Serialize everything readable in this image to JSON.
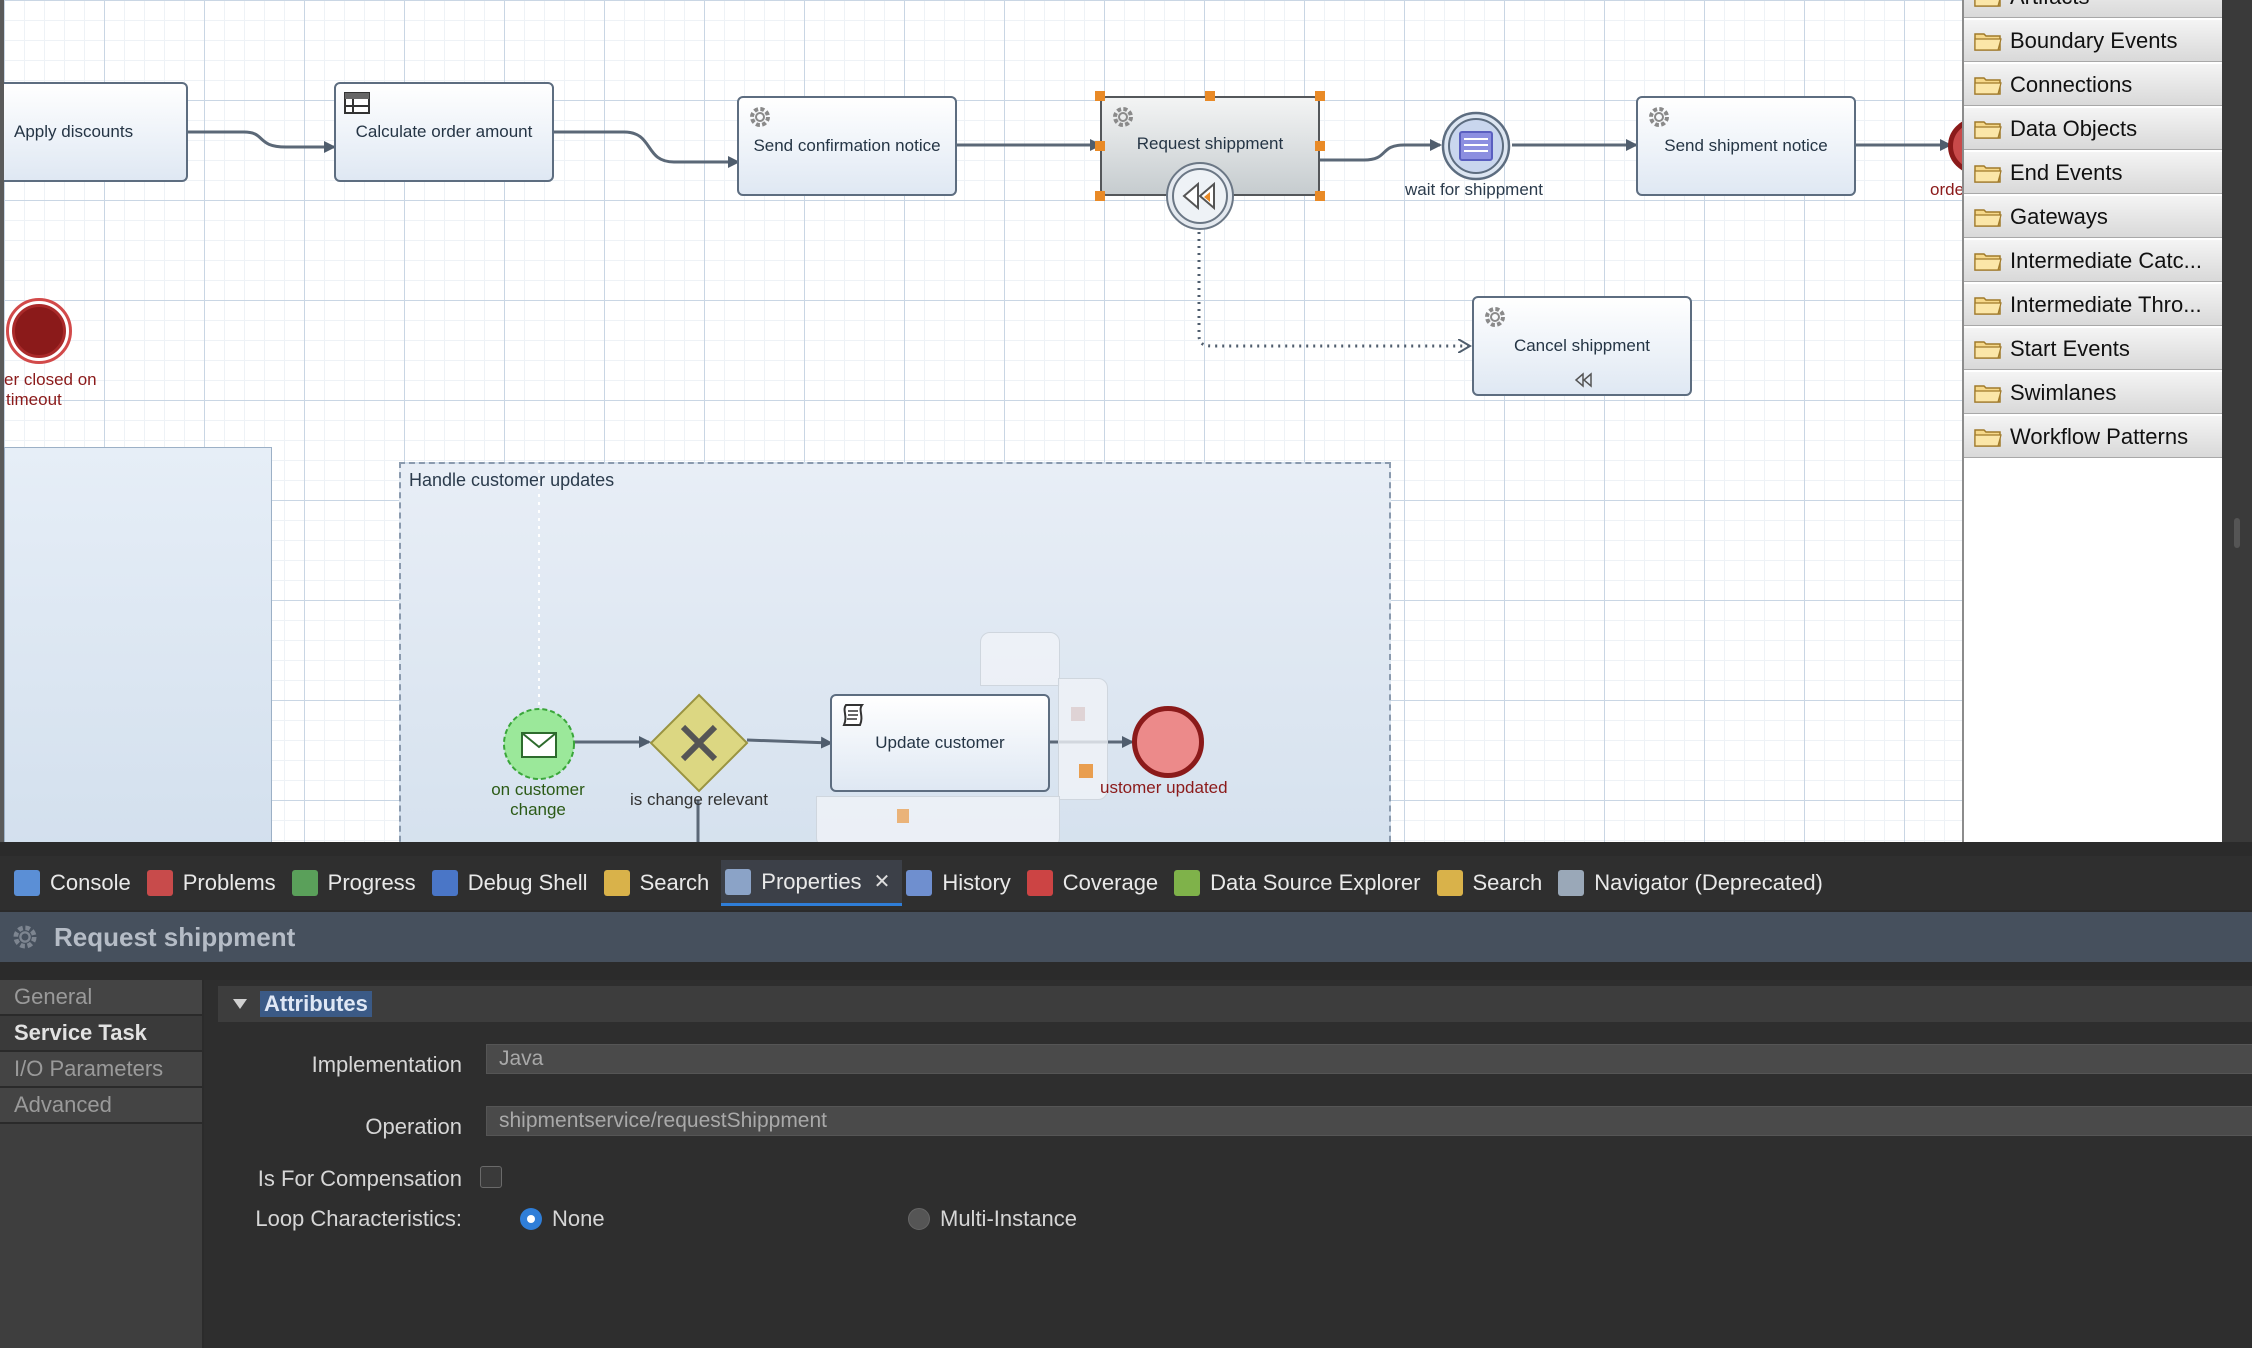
{
  "diagram": {
    "tasks": {
      "apply_discounts": "Apply discounts",
      "calculate_order_amount": "Calculate order amount",
      "send_confirmation_notice": "Send confirmation notice",
      "request_shippment": "Request shippment",
      "send_shipment_notice": "Send shipment notice",
      "cancel_shippment": "Cancel shippment",
      "update_customer": "Update customer"
    },
    "events": {
      "wait_for_shippment": "wait for shippment",
      "order_cut": "order",
      "closed_line1": "er closed on",
      "closed_line2": "timeout",
      "on_customer_change_line1": "on customer",
      "on_customer_change_line2": "change",
      "customer_updated": "ustomer updated"
    },
    "gateway_label": "is change relevant",
    "subprocess_label": "Handle customer updates"
  },
  "palette": {
    "items": [
      "Artifacts",
      "Boundary Events",
      "Connections",
      "Data Objects",
      "End Events",
      "Gateways",
      "Intermediate Catc...",
      "Intermediate Thro...",
      "Start Events",
      "Swimlanes",
      "Workflow Patterns"
    ]
  },
  "tabs": [
    {
      "label": "Console",
      "icon": "console-icon"
    },
    {
      "label": "Problems",
      "icon": "problems-icon"
    },
    {
      "label": "Progress",
      "icon": "progress-icon"
    },
    {
      "label": "Debug Shell",
      "icon": "debug-shell-icon"
    },
    {
      "label": "Search",
      "icon": "search-icon"
    },
    {
      "label": "Properties",
      "icon": "properties-icon",
      "active": true,
      "close": "✕"
    },
    {
      "label": "History",
      "icon": "history-icon"
    },
    {
      "label": "Coverage",
      "icon": "coverage-icon"
    },
    {
      "label": "Data Source Explorer",
      "icon": "data-source-icon"
    },
    {
      "label": "Search",
      "icon": "search-icon"
    },
    {
      "label": "Navigator (Deprecated)",
      "icon": "navigator-icon"
    }
  ],
  "properties": {
    "title": "Request shippment",
    "side_tabs": [
      "General",
      "Service Task",
      "I/O Parameters",
      "Advanced"
    ],
    "active_side_tab": "Service Task",
    "section": "Attributes",
    "implementation_label": "Implementation",
    "implementation_value": "Java",
    "operation_label": "Operation",
    "operation_value": "shipmentservice/requestShippment",
    "is_for_compensation_label": "Is For Compensation",
    "is_for_compensation_checked": false,
    "loop_label": "Loop Characteristics:",
    "loop_options": [
      "None",
      "Multi-Instance"
    ],
    "loop_selected": "None"
  },
  "colors": {
    "accent": "#2f7ed8",
    "end_event": "#8b1a1a",
    "start_event": "#8ee08a",
    "gateway": "#d8d27a",
    "selection": "#e98a26"
  }
}
